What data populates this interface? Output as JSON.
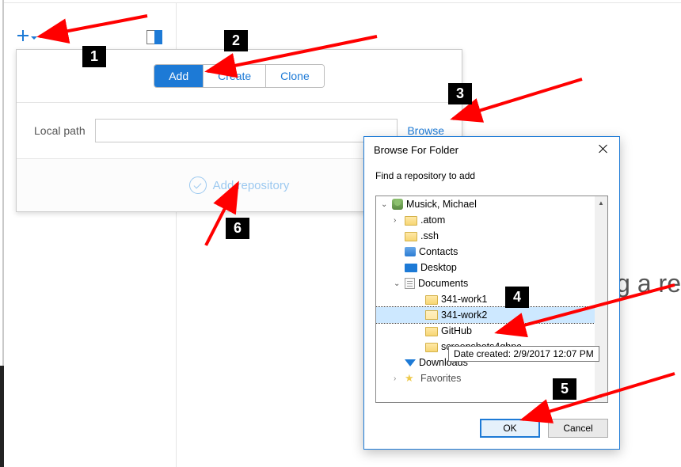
{
  "accent": "#1d7ad6",
  "plus_menu": {
    "name": "add-repo-menu"
  },
  "tabs": {
    "add": "Add",
    "create": "Create",
    "clone": "Clone"
  },
  "path": {
    "label": "Local path",
    "value": "",
    "browse": "Browse"
  },
  "submit": {
    "label": "Add repository"
  },
  "background_hint": "g a re",
  "dialog": {
    "title": "Browse For Folder",
    "subtitle": "Find a repository to add",
    "ok": "OK",
    "cancel": "Cancel"
  },
  "tree": {
    "root": "Musick, Michael",
    "items": [
      ".atom",
      ".ssh",
      "Contacts",
      "Desktop",
      "Documents",
      "341-work1",
      "341-work2",
      "GitHub",
      "screenshots4ghpc",
      "Downloads",
      "Favorites"
    ]
  },
  "tooltip": "Date created: 2/9/2017 12:07 PM",
  "badges": {
    "n1": "1",
    "n2": "2",
    "n3": "3",
    "n4": "4",
    "n5": "5",
    "n6": "6"
  }
}
